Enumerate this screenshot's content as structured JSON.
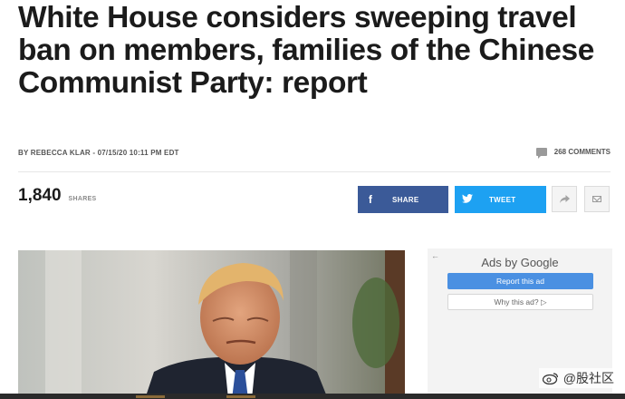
{
  "article": {
    "headline": "White House considers sweeping travel ban on members, families of the Chinese Communist Party: report",
    "byline": "BY REBECCA KLAR - 07/15/20 10:11 PM EDT",
    "comments_label": "268 COMMENTS",
    "shares_count": "1,840",
    "shares_label": "SHARES",
    "photo_alt": "Donald Trump"
  },
  "share_buttons": {
    "facebook_icon": "f",
    "facebook_label": "SHARE",
    "twitter_label": "TWEET",
    "forward_icon": "forward-icon",
    "mail_icon": "mail-icon"
  },
  "ad": {
    "back_arrow": "←",
    "title": "Ads by Google",
    "report_label": "Report this ad",
    "why_label": "Why this ad? ▷"
  },
  "watermark": {
    "text": "@股社区"
  },
  "colors": {
    "facebook": "#3b5a98",
    "twitter": "#1da1f2",
    "ad_button": "#4a90e2"
  }
}
